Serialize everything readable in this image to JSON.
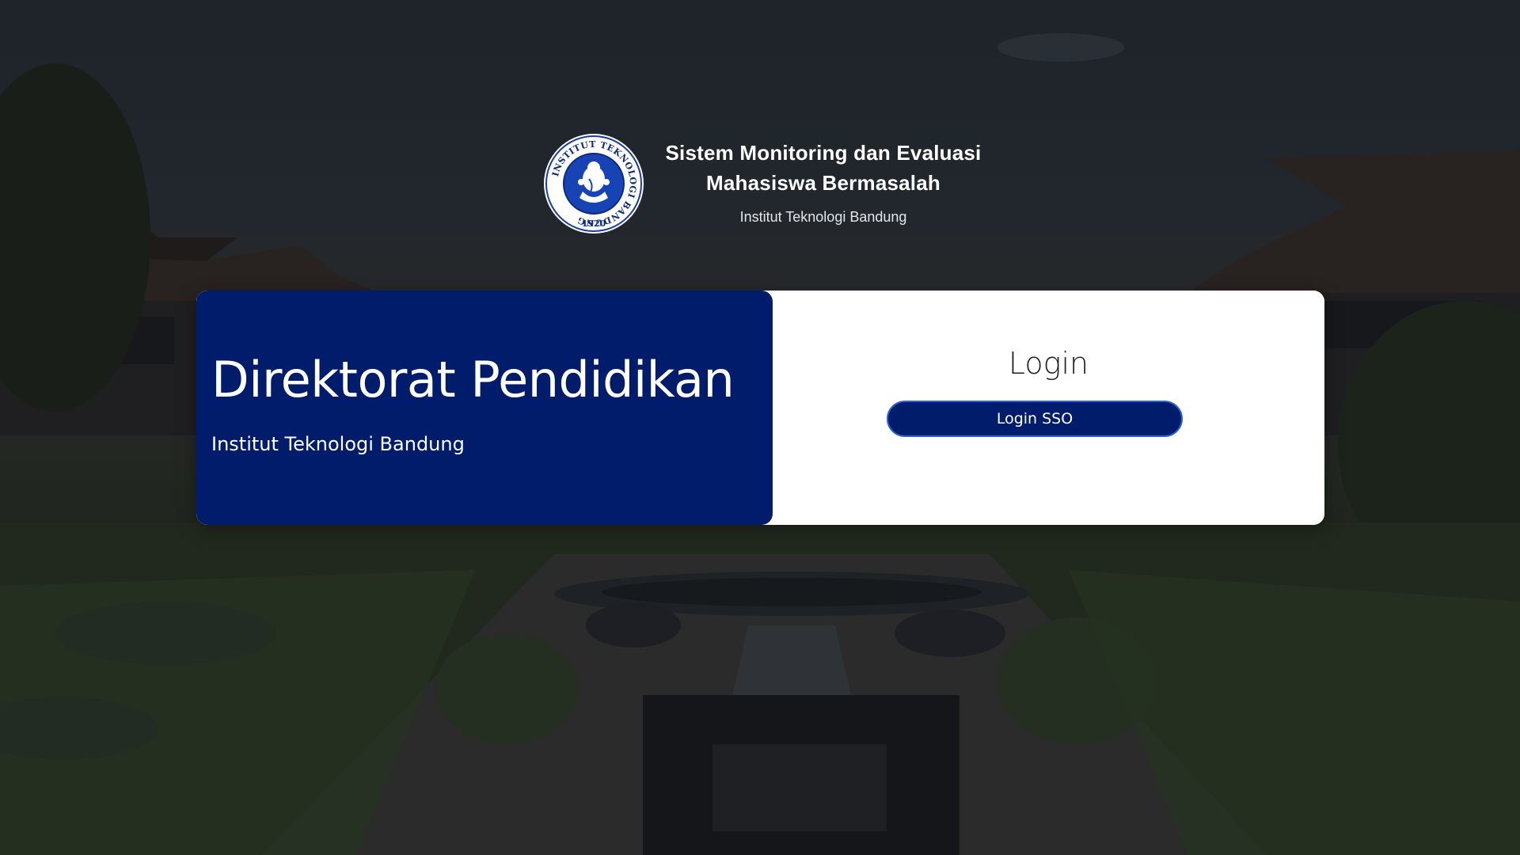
{
  "header": {
    "title_line1": "Sistem Monitoring dan Evaluasi",
    "title_line2": "Mahasiswa Bermasalah",
    "subtitle": "Institut Teknologi Bandung",
    "logo": {
      "icon": "itb-seal-logo",
      "ring_text": "INSTITUT TEKNOLOGI BANDUNG",
      "year": "1920"
    }
  },
  "panel_left": {
    "title": "Direktorat Pendidikan",
    "subtitle": "Institut Teknologi Bandung"
  },
  "panel_right": {
    "title": "Login",
    "button_label": "Login SSO"
  },
  "colors": {
    "brand_navy": "#001c6b",
    "button_border": "#2a63d6",
    "text_light": "#ffffff"
  }
}
